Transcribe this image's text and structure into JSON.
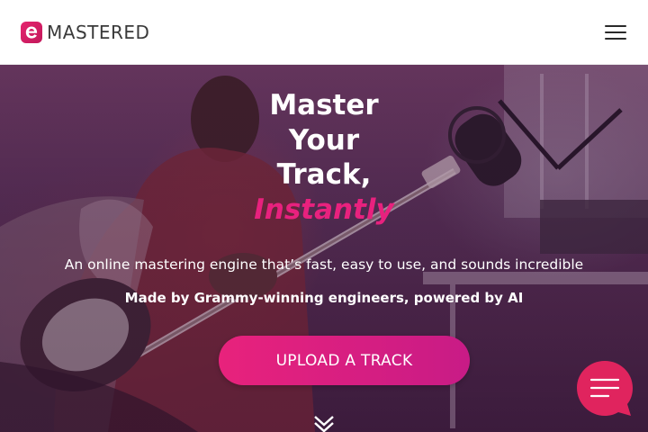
{
  "header": {
    "logo_text": "MASTERED",
    "logo_mark_letter": "e",
    "menu_icon": "hamburger-menu-icon"
  },
  "hero": {
    "headline_lines": [
      "Master",
      "Your",
      "Track,"
    ],
    "headline_accent": "Instantly",
    "subtitle": "An online mastering engine that’s fast, easy to use, and sounds incredible",
    "tagline": "Made by Grammy-winning engineers, powered by AI",
    "upload_button_label": "UPLOAD A TRACK",
    "scroll_icon": "double-chevron-down-icon",
    "chat_icon": "chat-bubble-icon"
  },
  "colors": {
    "brand_accent": "#e8217e",
    "button_gradient_start": "#e8227c",
    "button_gradient_end": "#c81b86",
    "chat_button": "#e0245e",
    "header_background": "#ffffff"
  }
}
